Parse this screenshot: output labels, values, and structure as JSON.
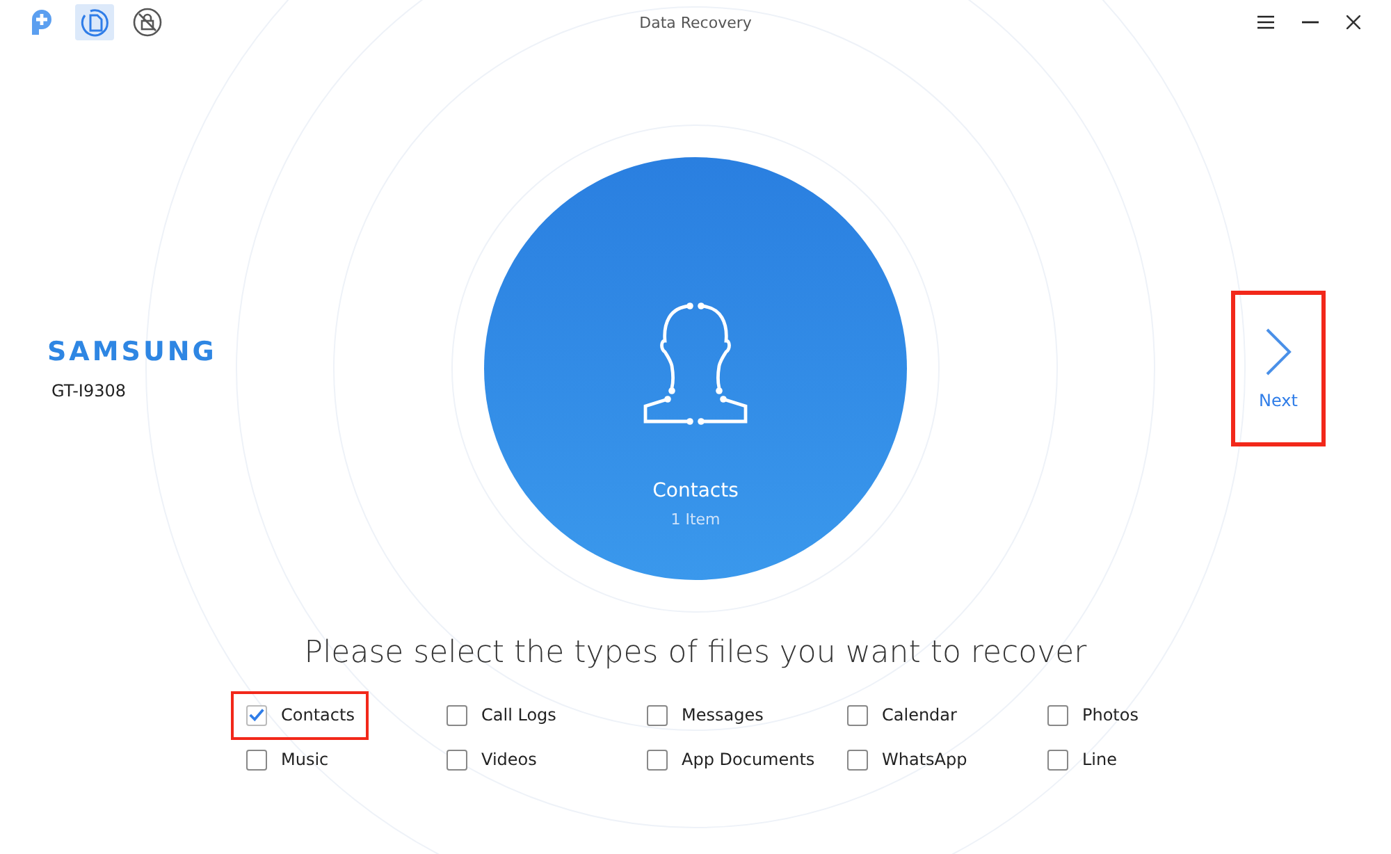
{
  "toolbar": [
    {
      "kind": "logo",
      "selected": false
    },
    {
      "kind": "recovery",
      "selected": true
    },
    {
      "kind": "lock",
      "selected": false
    }
  ],
  "window": {
    "title": "Data Recovery"
  },
  "device": {
    "brand": "SAMSUNG",
    "model": "GT-I9308"
  },
  "category": {
    "name": "Contacts",
    "count": "1 Item"
  },
  "next": {
    "label": "Next",
    "highlighted": true
  },
  "heading": "Please select the types of files you want to recover",
  "file_types": [
    {
      "label": "Contacts",
      "checked": true,
      "highlighted": true
    },
    {
      "label": "Call Logs",
      "checked": false,
      "highlighted": false
    },
    {
      "label": "Messages",
      "checked": false,
      "highlighted": false
    },
    {
      "label": "Calendar",
      "checked": false,
      "highlighted": false
    },
    {
      "label": "Photos",
      "checked": false,
      "highlighted": false
    },
    {
      "label": "Music",
      "checked": false,
      "highlighted": false
    },
    {
      "label": "Videos",
      "checked": false,
      "highlighted": false
    },
    {
      "label": "App Documents",
      "checked": false,
      "highlighted": false
    },
    {
      "label": "WhatsApp",
      "checked": false,
      "highlighted": false
    },
    {
      "label": "Line",
      "checked": false,
      "highlighted": false
    }
  ]
}
